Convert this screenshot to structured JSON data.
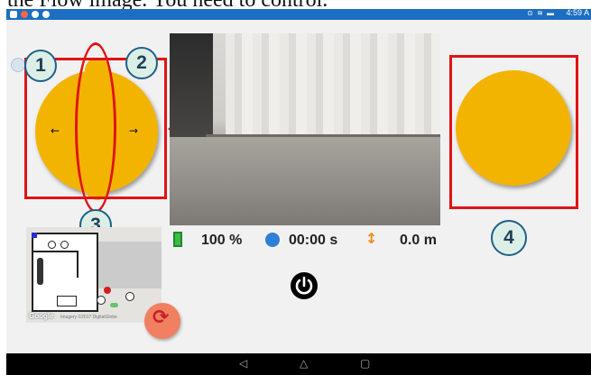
{
  "caption": {
    "text": "the Flow image. You need to control."
  },
  "statusbar": {
    "time": "4:59 A",
    "system_icons": "⊙ ≋ ▬"
  },
  "annotations": {
    "badge1": "1",
    "badge2": "2",
    "badge3": "3",
    "badge4": "4"
  },
  "joystick": {
    "left_arrow": "←",
    "right_arrow": "→"
  },
  "stats": {
    "battery": "100 %",
    "time": "00:00 s",
    "distance": "0.0 m"
  },
  "map": {
    "attribution": "Google",
    "imagery": "Imagery ©2017 DigitalGlobe"
  },
  "colors": {
    "accent_yellow": "#f3b400",
    "annotation_red": "#e01414",
    "refresh": "#f08060",
    "statusbar": "#1b6ec2"
  }
}
